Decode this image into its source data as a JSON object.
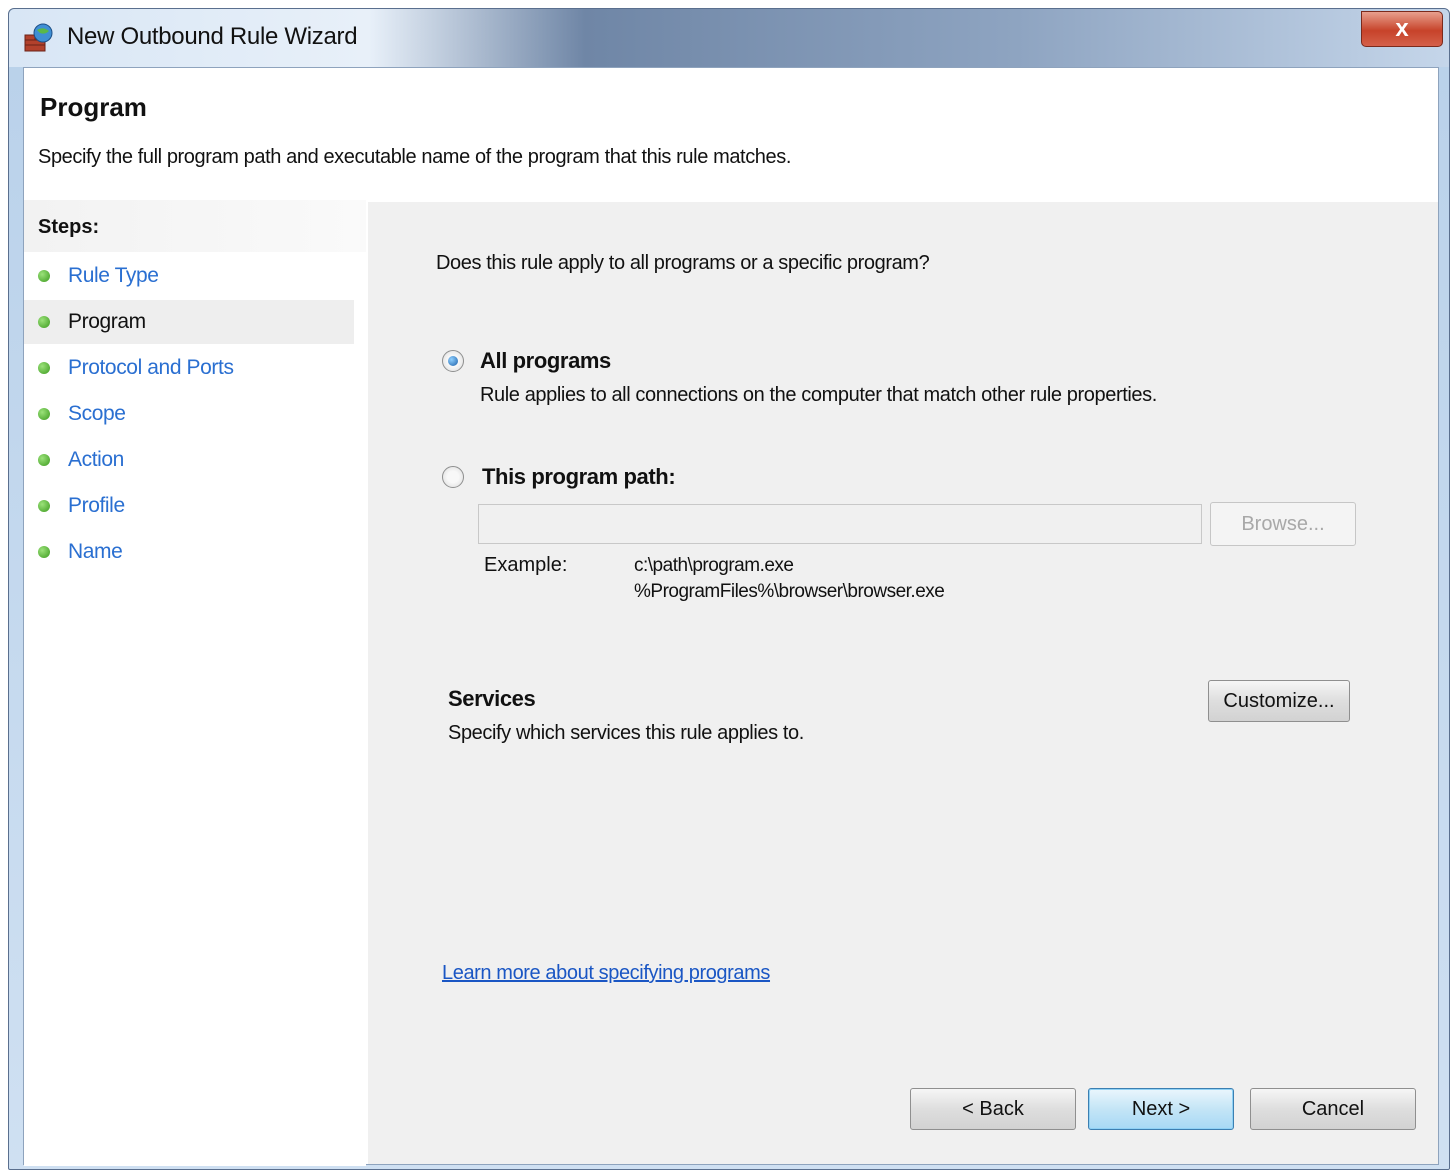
{
  "window": {
    "title": "New Outbound Rule Wizard",
    "close_label": "x"
  },
  "header": {
    "title": "Program",
    "description": "Specify the full program path and executable name of the program that this rule matches."
  },
  "sidebar": {
    "heading": "Steps:",
    "items": [
      {
        "label": "Rule Type",
        "state": "done"
      },
      {
        "label": "Program",
        "state": "current"
      },
      {
        "label": "Protocol and Ports",
        "state": "pending"
      },
      {
        "label": "Scope",
        "state": "pending"
      },
      {
        "label": "Action",
        "state": "pending"
      },
      {
        "label": "Profile",
        "state": "pending"
      },
      {
        "label": "Name",
        "state": "pending"
      }
    ]
  },
  "main": {
    "question": "Does this rule apply to all programs or a specific program?",
    "all_programs": {
      "label": "All programs",
      "description": "Rule applies to all connections on the computer that match other rule properties.",
      "selected": true
    },
    "this_program": {
      "label": "This program path:",
      "selected": false,
      "path_value": "",
      "browse_label": "Browse...",
      "example_label": "Example:",
      "example_line1": "c:\\path\\program.exe",
      "example_line2": "%ProgramFiles%\\browser\\browser.exe"
    },
    "services": {
      "title": "Services",
      "description": "Specify which services this rule applies to.",
      "customize_label": "Customize..."
    },
    "learn_more": "Learn more about specifying programs"
  },
  "footer": {
    "back_label": "< Back",
    "next_label": "Next >",
    "cancel_label": "Cancel"
  },
  "colors": {
    "link": "#1a56c4",
    "step_done_dot": "#3c9a1e",
    "content_bg": "#f0f0f0"
  }
}
